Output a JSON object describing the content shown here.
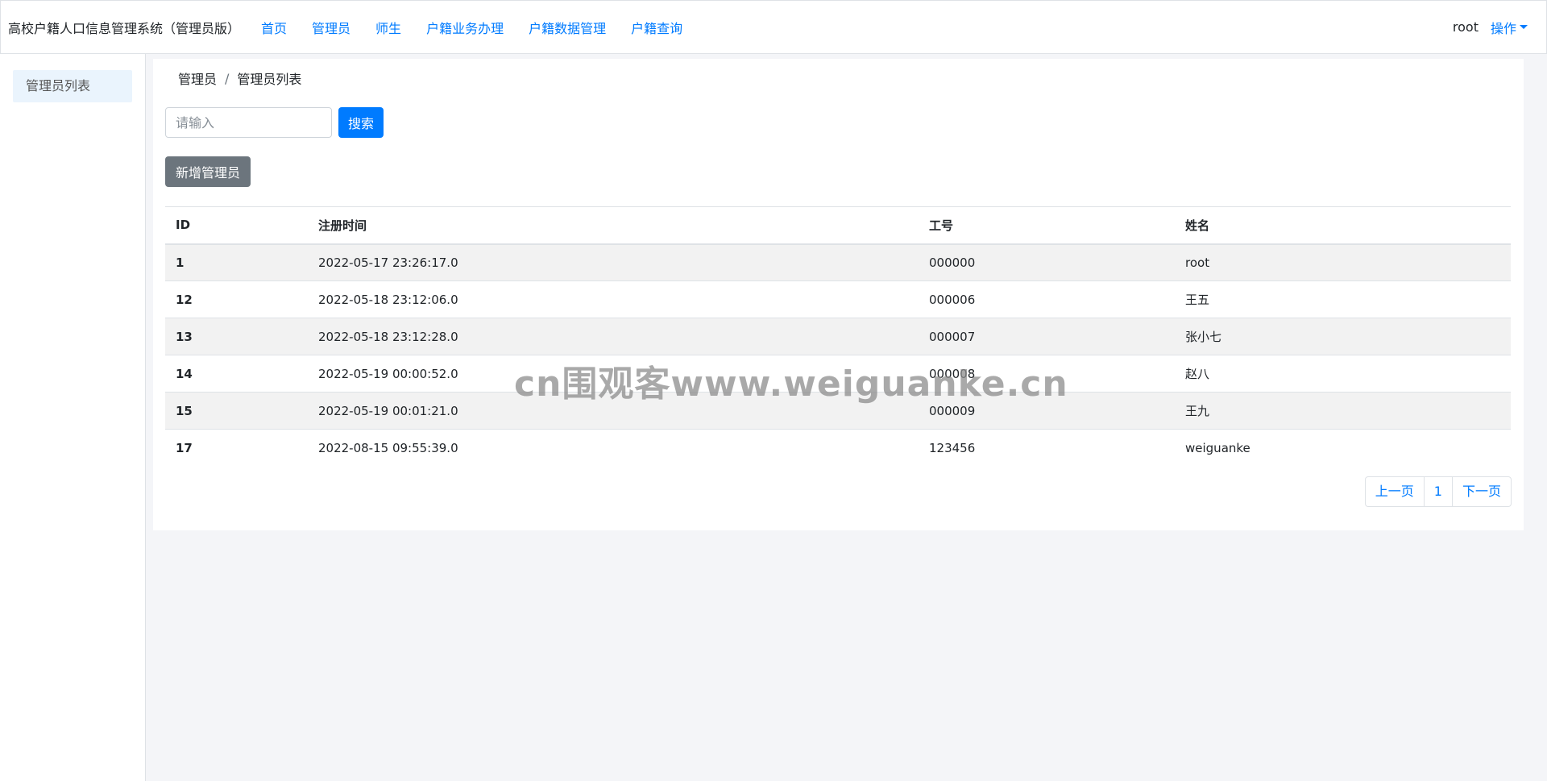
{
  "navbar": {
    "brand": "高校户籍人口信息管理系统（管理员版）",
    "links": [
      "首页",
      "管理员",
      "师生",
      "户籍业务办理",
      "户籍数据管理",
      "户籍查询"
    ],
    "user": "root",
    "operations": "操作"
  },
  "sidebar": {
    "items": [
      "管理员列表"
    ]
  },
  "breadcrumb": {
    "parent": "管理员",
    "separator": "/",
    "current": "管理员列表"
  },
  "search": {
    "placeholder": "请输入",
    "value": "",
    "button": "搜索"
  },
  "add_button": "新增管理员",
  "table": {
    "headers": [
      "ID",
      "注册时间",
      "工号",
      "姓名"
    ],
    "rows": [
      [
        "1",
        "2022-05-17 23:26:17.0",
        "000000",
        "root"
      ],
      [
        "12",
        "2022-05-18 23:12:06.0",
        "000006",
        "王五"
      ],
      [
        "13",
        "2022-05-18 23:12:28.0",
        "000007",
        "张小七"
      ],
      [
        "14",
        "2022-05-19 00:00:52.0",
        "000008",
        "赵八"
      ],
      [
        "15",
        "2022-05-19 00:01:21.0",
        "000009",
        "王九"
      ],
      [
        "17",
        "2022-08-15 09:55:39.0",
        "123456",
        "weiguanke"
      ]
    ]
  },
  "pagination": {
    "prev": "上一页",
    "page": "1",
    "next": "下一页"
  },
  "watermark": "cn围观客www.weiguanke.cn",
  "colors": {
    "primary": "#007bff",
    "secondary": "#6c757d",
    "background": "#f4f5f8",
    "sidebar_active": "#eaf4fd"
  }
}
